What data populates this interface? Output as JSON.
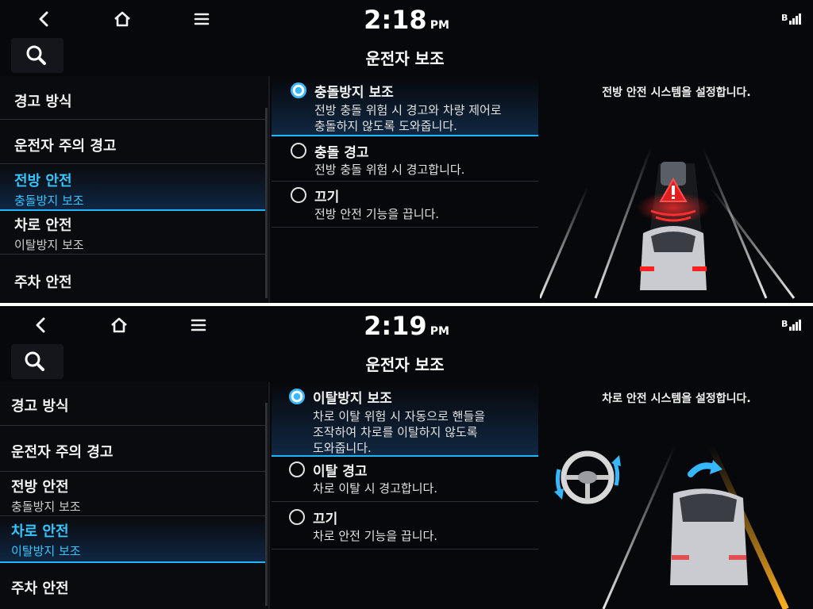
{
  "screens": [
    {
      "clock": {
        "time": "2:18",
        "ampm": "PM"
      },
      "title": "운전자 보조",
      "sidebar": [
        {
          "label": "경고 방식",
          "sub": ""
        },
        {
          "label": "운전자 주의 경고",
          "sub": ""
        },
        {
          "label": "전방 안전",
          "sub": "충돌방지 보조",
          "active": true
        },
        {
          "label": "차로 안전",
          "sub": "이탈방지 보조"
        },
        {
          "label": "주차 안전",
          "sub": ""
        }
      ],
      "options": [
        {
          "title": "충돌방지 보조",
          "desc": [
            "전방 충돌 위험 시 경고와 차량 제어로",
            "충돌하지 않도록 도와줍니다."
          ],
          "selected": true
        },
        {
          "title": "충돌 경고",
          "desc": [
            "전방 충돌 위험 시 경고합니다."
          ]
        },
        {
          "title": "끄기",
          "desc": [
            "전방 안전 기능을 끕니다."
          ]
        }
      ],
      "right_text": "전방 안전 시스템을 설정합니다.",
      "icons": {
        "back": "back-chevron-icon",
        "home": "home-icon",
        "menu": "menu-icon",
        "search": "search-icon",
        "signal": "signal-icon"
      }
    },
    {
      "clock": {
        "time": "2:19",
        "ampm": "PM"
      },
      "title": "운전자 보조",
      "sidebar": [
        {
          "label": "경고 방식",
          "sub": ""
        },
        {
          "label": "운전자 주의 경고",
          "sub": ""
        },
        {
          "label": "전방 안전",
          "sub": "충돌방지 보조"
        },
        {
          "label": "차로 안전",
          "sub": "이탈방지 보조",
          "active": true
        },
        {
          "label": "주차 안전",
          "sub": ""
        }
      ],
      "options": [
        {
          "title": "이탈방지 보조",
          "desc": [
            "차로 이탈 위험 시 자동으로 핸들을",
            "조작하여 차로를 이탈하지 않도록",
            "도와줍니다."
          ],
          "selected": true
        },
        {
          "title": "이탈 경고",
          "desc": [
            "차로 이탈 시 경고합니다."
          ]
        },
        {
          "title": "끄기",
          "desc": [
            "차로 안전 기능을 끕니다."
          ]
        }
      ],
      "right_text": "차로 안전 시스템을 설정합니다.",
      "icons": {
        "back": "back-chevron-icon",
        "home": "home-icon",
        "menu": "menu-icon",
        "search": "search-icon",
        "signal": "signal-icon"
      }
    }
  ],
  "colors": {
    "accent": "#1fb6ff",
    "background": "#07080b",
    "warning": "#e02020",
    "lane_yellow": "#f0a020"
  }
}
